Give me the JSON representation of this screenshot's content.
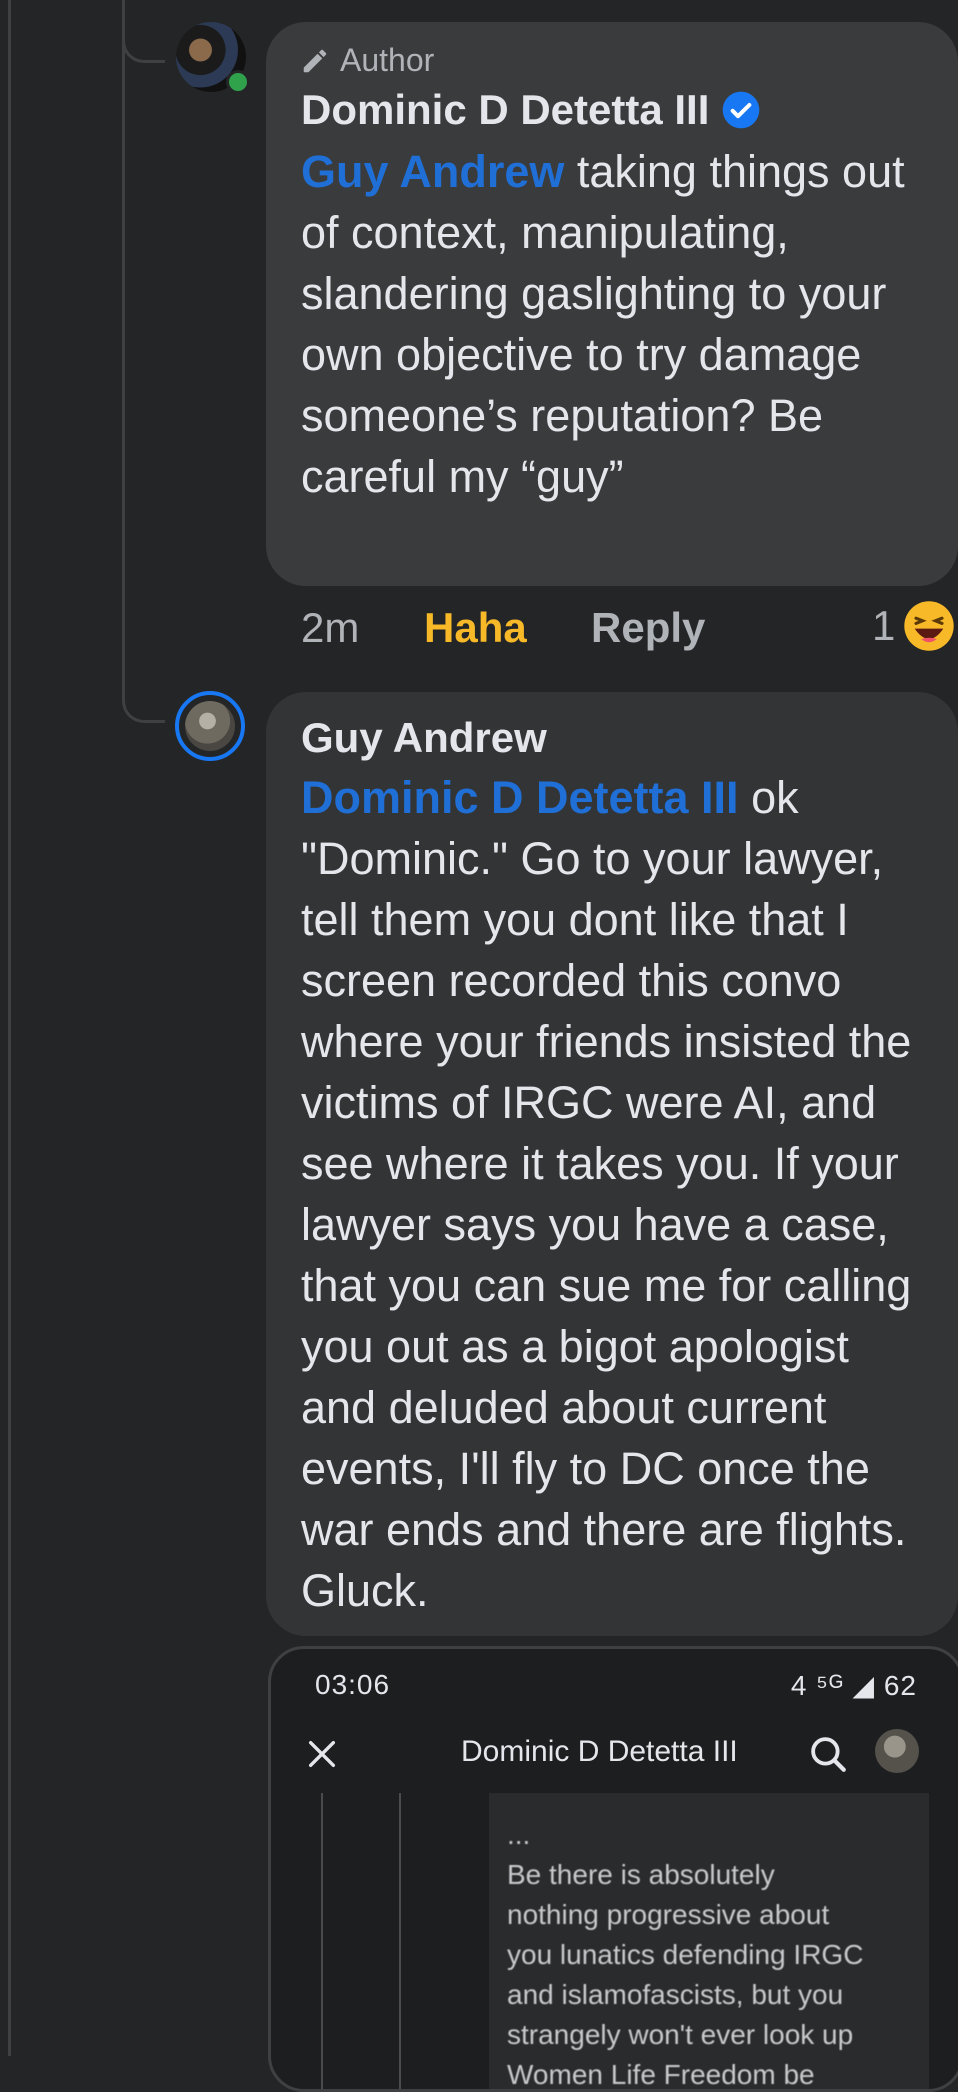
{
  "comments": [
    {
      "author_badge": "Author",
      "name": "Dominic D Detetta III",
      "verified": true,
      "mention": "Guy Andrew",
      "text": " taking things out of context, manipulating, slandering gaslighting to your own objective to try damage someone’s reputation? Be careful my “guy”",
      "time": "2m",
      "reaction_action": "Haha",
      "reply_label": "Reply",
      "reaction_count": "1",
      "reaction_icon": "haha-emoji-icon"
    },
    {
      "name": "Guy Andrew",
      "mention": "Dominic D Detetta III",
      "text": " ok \"Dominic.\" Go to your lawyer, tell them you dont like that I screen recorded this convo where your friends insisted the victims of IRGC were AI, and see where it takes you. If your lawyer says you have a case, that you can sue me for calling you out as a bigot apologist and deluded about current events, I'll fly to DC once the war ends and there are flights. Gluck."
    }
  ],
  "attachment": {
    "status_time": "03:06",
    "status_right": "4 ⁵ᴳ ◢ 62",
    "title": "Dominic D Detetta III",
    "blurred_text": "...\nBe there is absolutely\nnothing progressive about\nyou lunatics defending IRGC\nand islamofascists, but you\nstrangely won't ever look up\nWomen Life Freedom be\n..."
  },
  "colors": {
    "background": "#242526",
    "bubble": "#3a3b3c",
    "mention": "#1f6fd6",
    "haha": "#f7b928",
    "verified": "#1877f2",
    "online": "#31a24c"
  }
}
